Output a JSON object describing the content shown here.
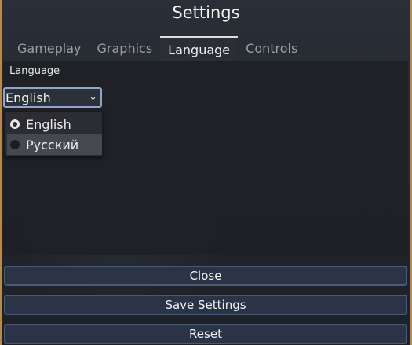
{
  "window": {
    "title": "Settings"
  },
  "tabs": [
    {
      "label": "Gameplay",
      "active": false
    },
    {
      "label": "Graphics",
      "active": false
    },
    {
      "label": "Language",
      "active": true
    },
    {
      "label": "Controls",
      "active": false
    }
  ],
  "language": {
    "label": "Language",
    "selected": "English",
    "options": [
      {
        "label": "English",
        "checked": true
      },
      {
        "label": "Русский",
        "checked": false
      }
    ]
  },
  "buttons": {
    "close": "Close",
    "save": "Save Settings",
    "reset": "Reset"
  },
  "colors": {
    "accent": "#8fa6c8",
    "frame": "#b9884e",
    "button_bg": "#2a3446"
  }
}
